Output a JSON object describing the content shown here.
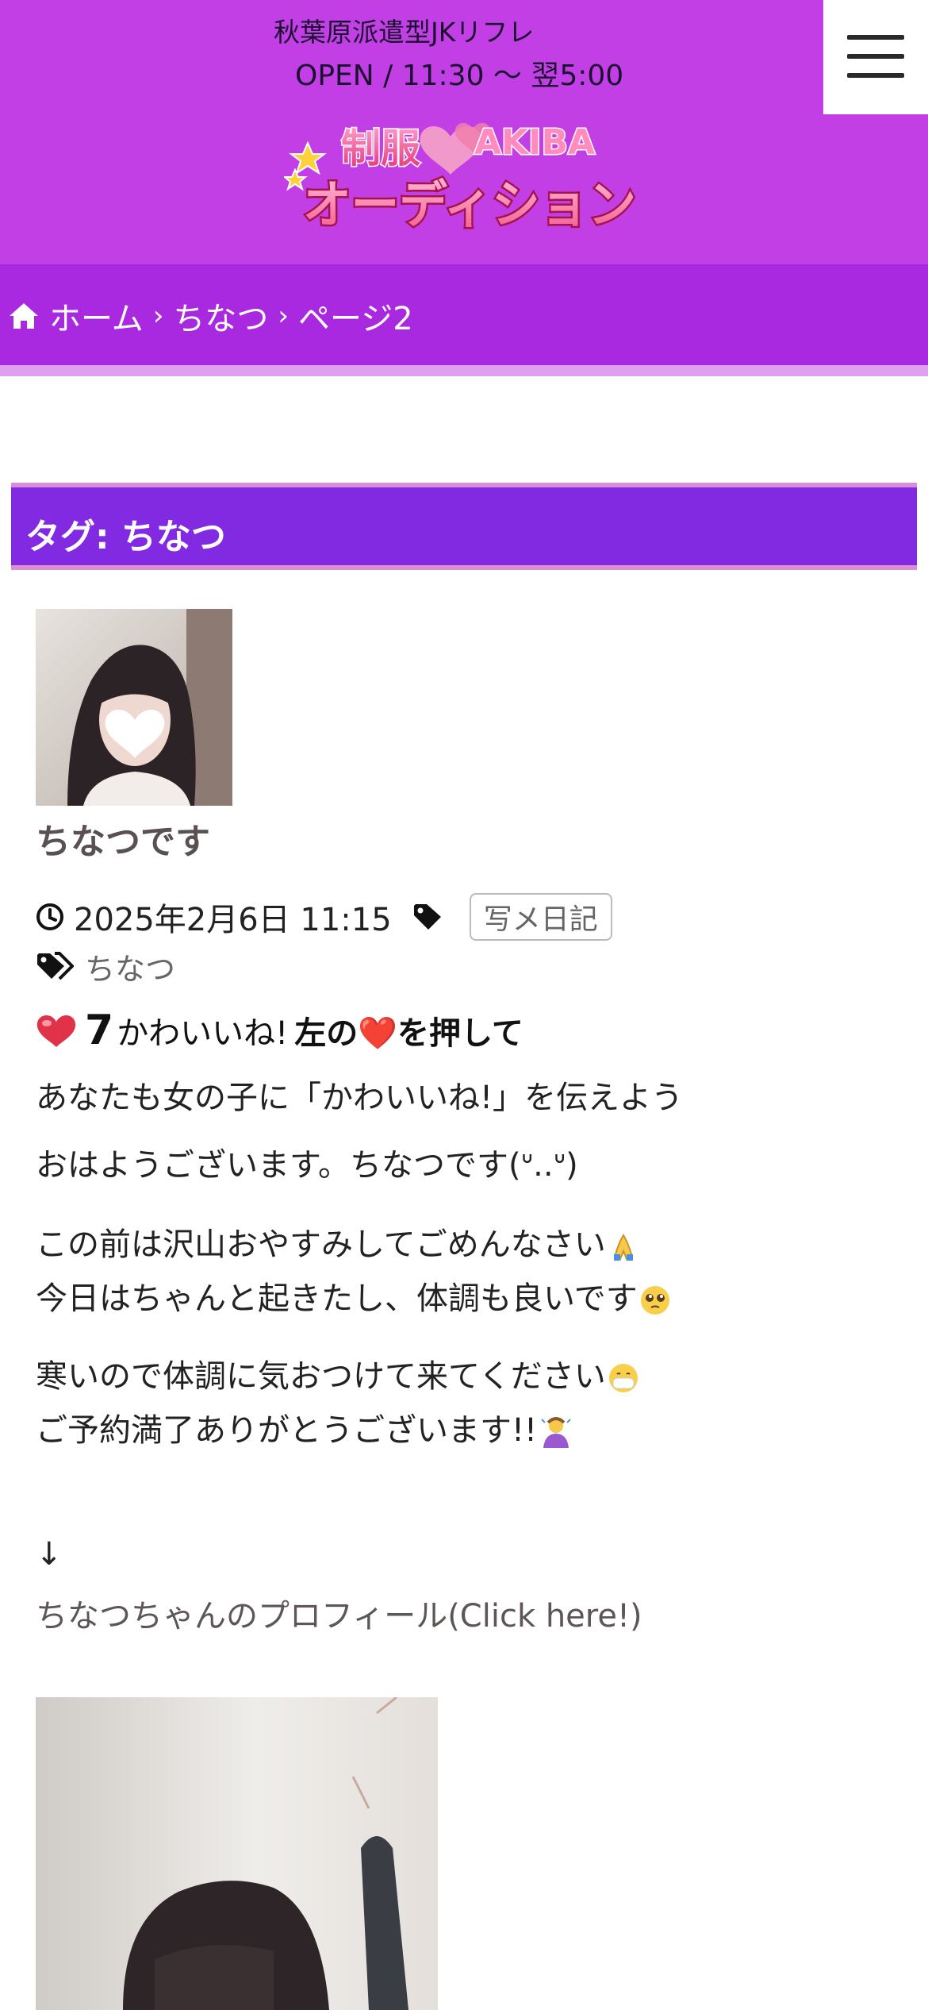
{
  "header": {
    "tagline": "秋葉原派遣型JKリフレ",
    "hours": "OPEN /  11:30 〜 翌5:00",
    "logo_top": "制服",
    "logo_akiba": "AKIBA",
    "logo_bottom": "オーディション",
    "menu_icon": "hamburger-menu-icon",
    "bg_color": "#c23fe6"
  },
  "breadcrumb": {
    "home_icon": "home-icon",
    "home": "ホーム",
    "sep": "›",
    "item1": "ちなつ",
    "item2": "ページ2"
  },
  "tag_heading": "タグ: ちなつ",
  "post": {
    "thumbnail_icon": "heart-icon",
    "title": "ちなつです",
    "date": "2025年2月6日 11:15",
    "clock_icon": "clock-icon",
    "tag_icon": "tag-icon",
    "category": "写メ日記",
    "tags_icon": "tags-icon",
    "tag": "ちなつ",
    "like": {
      "icon": "heart-icon",
      "count": "7",
      "text": "かわいいね!",
      "cta": "左の❤️を押して",
      "subtitle": "あなたも女の子に「かわいいね!」を伝えよう"
    },
    "body": [
      "おはようございます。ちなつです(ᐡ..ᐡ)",
      "この前は沢山おやすみしてごめんなさい",
      "今日はちゃんと起きたし、体調も良いです",
      "寒いので体調に気おつけて来てください",
      "ご予約満了ありがとうございます!!"
    ],
    "emojis": [
      "praying-hands-icon",
      "pleading-face-icon",
      "mask-face-icon",
      "bowing-person-icon"
    ],
    "arrow": "↓",
    "profile_link": "ちなつちゃんのプロフィール(Click here!)"
  }
}
